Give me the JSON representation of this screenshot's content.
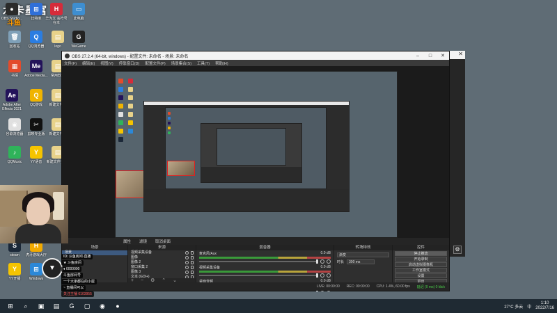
{
  "desktop": {
    "stream_title": "水卡墨富",
    "logo_badge": "斗鱼",
    "icons": [
      {
        "label": "OBS Studio...",
        "color": "#2b2b2b",
        "glyph": "●"
      },
      {
        "label": "比特率",
        "color": "#2f6fd8",
        "glyph": "⊞"
      },
      {
        "label": "华为文 会符号在本",
        "color": "#d62b3a",
        "glyph": "H"
      },
      {
        "label": "此电脑",
        "color": "#3e8ed0",
        "glyph": "▭"
      },
      {
        "label": "回收站",
        "color": "#7fa0b8",
        "glyph": "🗑"
      },
      {
        "label": "QQ浏览器",
        "color": "#2a7de1",
        "glyph": "Q"
      },
      {
        "label": "logo",
        "color": "#e8d28a",
        "glyph": "▤"
      },
      {
        "label": "WeGame",
        "color": "#222222",
        "glyph": "G"
      },
      {
        "label": "书情",
        "color": "#e34b2b",
        "glyph": "▦"
      },
      {
        "label": "Adobe Media...",
        "color": "#23135a",
        "glyph": "Me"
      },
      {
        "label": "常用软件",
        "color": "#e8d28a",
        "glyph": "▤"
      },
      {
        "label": "Adobe After Effects 2021",
        "color": "#23135a",
        "glyph": "Ae"
      },
      {
        "label": "QQ游戏",
        "color": "#f0b400",
        "glyph": "Q"
      },
      {
        "label": "新建文件夹",
        "color": "#e8d28a",
        "glyph": "▤"
      },
      {
        "label": "谷歌浏览器",
        "color": "#e0e0e0",
        "glyph": "◉"
      },
      {
        "label": "剪映专业版",
        "color": "#111111",
        "glyph": "✂"
      },
      {
        "label": "新建文件夹",
        "color": "#e8d28a",
        "glyph": "▤"
      },
      {
        "label": "QQMusic",
        "color": "#2fb35a",
        "glyph": "♪"
      },
      {
        "label": "YY语音",
        "color": "#f5c400",
        "glyph": "Y"
      },
      {
        "label": "新建文件夹 (2)",
        "color": "#e8d28a",
        "glyph": "▤"
      },
      {
        "label": "steam",
        "color": "#1b2838",
        "glyph": "S"
      },
      {
        "label": "虎牙游戏大厅",
        "color": "#f2aa00",
        "glyph": "H"
      },
      {
        "label": "YY开播",
        "color": "#f5c400",
        "glyph": "Y"
      },
      {
        "label": "Windows",
        "color": "#2b88d8",
        "glyph": "⊞"
      }
    ]
  },
  "chat_overlay": {
    "lines": [
      "ID: 斗鱼房间·直播",
      "★ 斗鱼房间",
      "♦ 0000000",
      "斗鱼房间号",
      "一个大家都在的小屋",
      "~ 直播间可以",
      "关注主播 6103955"
    ]
  },
  "obs": {
    "title": "OBS 27.2.4 (64-bit, windows) - 配置文件: 未命名 - 场景: 未命名",
    "menu": [
      "文件(F)",
      "编辑(E)",
      "视图(V)",
      "停靠窗口(D)",
      "配置文件(P)",
      "场景集合(S)",
      "工具(T)",
      "帮助(H)"
    ],
    "window_buttons": {
      "minimize": "–",
      "maximize": "□",
      "close": "✕"
    },
    "preview_bar": [
      "属性",
      "滤镜",
      "取消桌面"
    ],
    "docks": {
      "scenes": {
        "header": "场景",
        "items": [
          "场景",
          "场景 2"
        ]
      },
      "sources": {
        "header": "来源",
        "items": [
          "视频采集设备",
          "图像",
          "图像 2",
          "窗口采集 2",
          "图像 3",
          "文本 (GDI+)",
          "显示器采集"
        ]
      },
      "mixer": {
        "header": "混音器",
        "channels": [
          {
            "name": "麦克风/Aux",
            "db": "0.0 dB"
          },
          {
            "name": "视频采集设备",
            "db": "0.0 dB"
          },
          {
            "name": "桌面音频",
            "db": "0.0 dB"
          }
        ]
      },
      "transitions": {
        "header": "转场特效",
        "selected": "渐变",
        "duration_label": "时长",
        "duration": "300 ms"
      },
      "controls": {
        "header": "控件",
        "buttons": [
          "停止推流",
          "开始录制",
          "启动虚拟摄像机",
          "工作室模式",
          "设置",
          "退出"
        ]
      }
    },
    "status": {
      "live": "LIVE: 00:00:00",
      "rec": "REC: 00:00:00",
      "cpu": "CPU: 1.4%, 60.00 fps",
      "kbps": "延迟 (0 ms) 0 kb/s"
    }
  },
  "back_window": {
    "settings_glyph": "⚙",
    "close": "✕"
  },
  "taskbar": {
    "icons": [
      "⊞",
      "⌕",
      "▣",
      "▤",
      "G",
      "▢",
      "◉",
      "●"
    ],
    "tray_temp": "27°C 多云",
    "tray_lang": "中",
    "clock_time": "1:10",
    "clock_date": "2022/7/16"
  }
}
